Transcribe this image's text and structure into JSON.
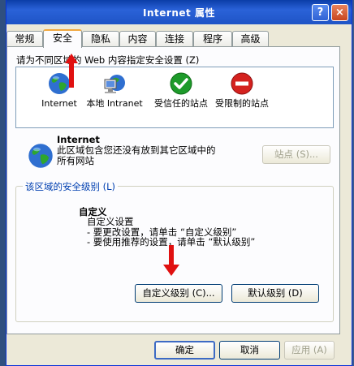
{
  "window": {
    "title": "Internet 属性",
    "help": "?",
    "close": "×"
  },
  "tabs": [
    {
      "label": "常规"
    },
    {
      "label": "安全"
    },
    {
      "label": "隐私"
    },
    {
      "label": "内容"
    },
    {
      "label": "连接"
    },
    {
      "label": "程序"
    },
    {
      "label": "高级"
    }
  ],
  "zones": {
    "prompt": "请为不同区域的 Web 内容指定安全设置 (Z)",
    "items": [
      {
        "label": "Internet",
        "icon": "globe-icon"
      },
      {
        "label": "本地 Intranet",
        "icon": "local-intranet-icon"
      },
      {
        "label": "受信任的站点",
        "icon": "trusted-sites-icon"
      },
      {
        "label": "受限制的站点",
        "icon": "restricted-sites-icon"
      }
    ]
  },
  "selected_zone": {
    "title": "Internet",
    "description": "此区域包含您还没有放到其它区域中的所有网站",
    "sites_button": "站点 (S)..."
  },
  "security_level": {
    "group_label": "该区域的安全级别 (L)",
    "level_title": "自定义",
    "lines": [
      "自定义设置",
      "- 要更改设置，请单击 “自定义级别”",
      "- 要使用推荐的设置，请单击 “默认级别”"
    ],
    "custom_button": "自定义级别 (C)...",
    "default_button": "默认级别 (D)"
  },
  "footer": {
    "ok": "确定",
    "cancel": "取消",
    "apply": "应用 (A)"
  },
  "colors": {
    "annotation_arrow": "#e01010",
    "title_bar": "#1f54c6",
    "tab_highlight": "#f1a73d"
  }
}
